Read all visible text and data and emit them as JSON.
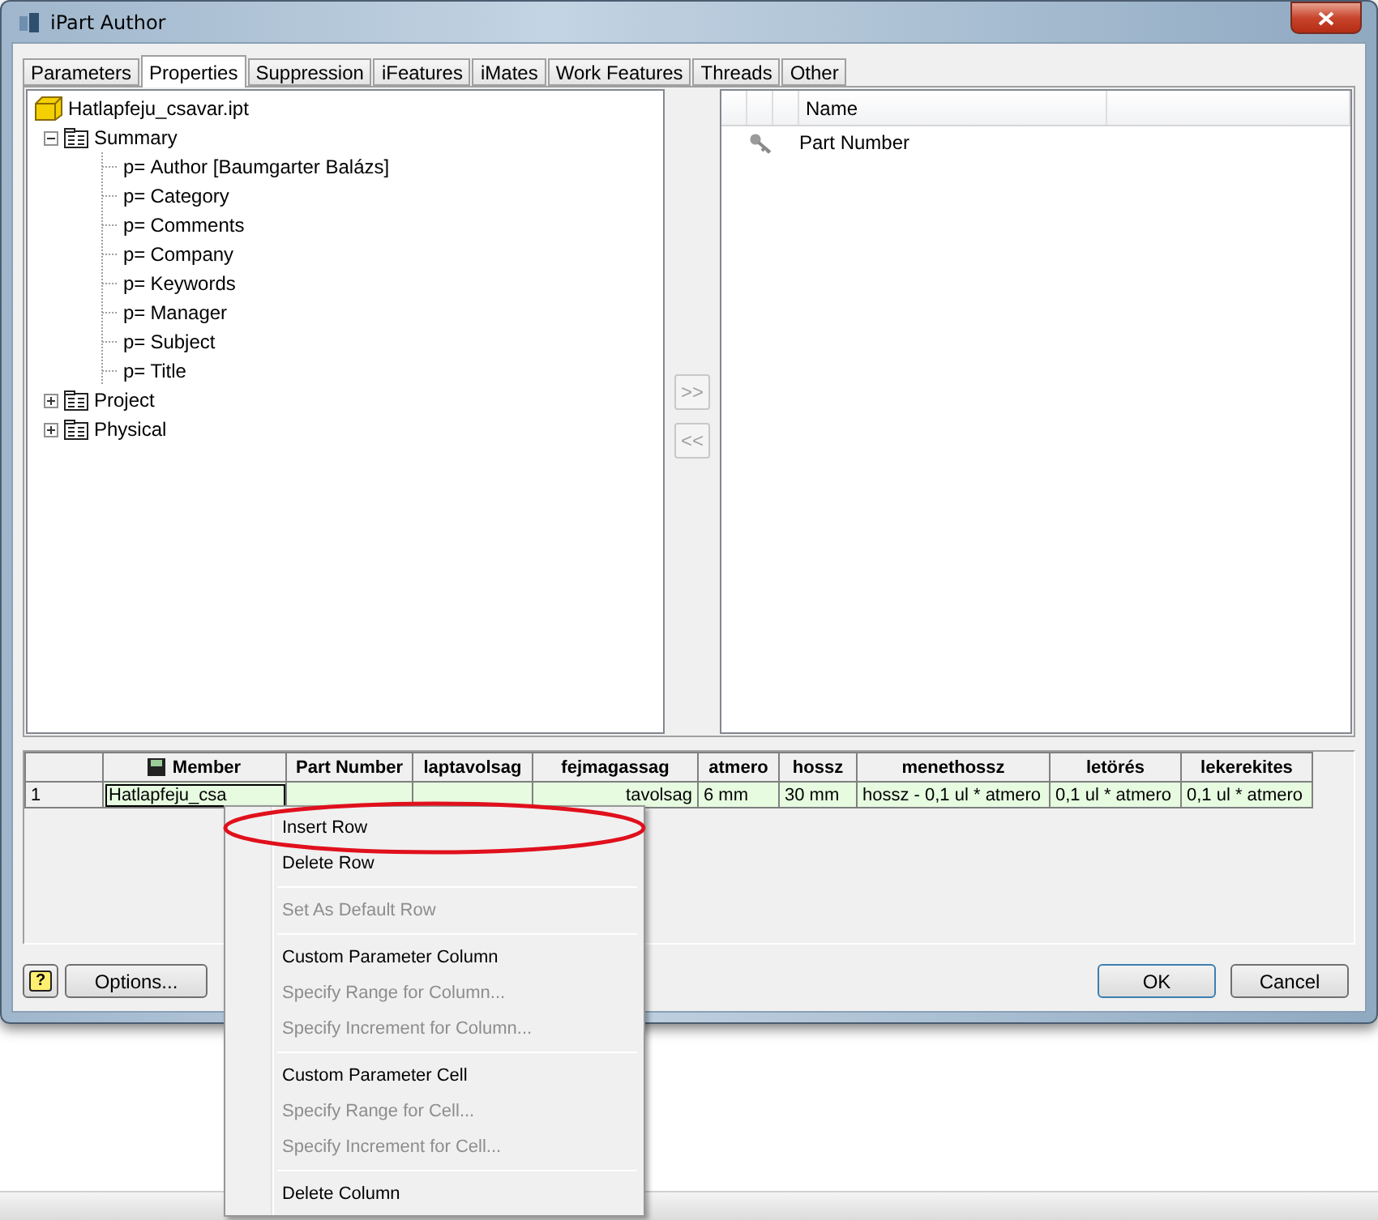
{
  "window": {
    "title": "iPart Author"
  },
  "tabs": [
    {
      "label": "Parameters",
      "selected": false
    },
    {
      "label": "Properties",
      "selected": true
    },
    {
      "label": "Suppression",
      "selected": false
    },
    {
      "label": "iFeatures",
      "selected": false
    },
    {
      "label": "iMates",
      "selected": false
    },
    {
      "label": "Work Features",
      "selected": false
    },
    {
      "label": "Threads",
      "selected": false
    },
    {
      "label": "Other",
      "selected": false
    }
  ],
  "tree": {
    "root": "Hatlapfeju_csavar.ipt",
    "children": [
      {
        "label": "Summary",
        "expanded": true,
        "children": [
          {
            "label": "Author [Baumgarter Balázs]",
            "icon_text": "p="
          },
          {
            "label": "Category",
            "icon_text": "p="
          },
          {
            "label": "Comments",
            "icon_text": "p="
          },
          {
            "label": "Company",
            "icon_text": "p="
          },
          {
            "label": "Keywords",
            "icon_text": "p="
          },
          {
            "label": "Manager",
            "icon_text": "p="
          },
          {
            "label": "Subject",
            "icon_text": "p="
          },
          {
            "label": "Title",
            "icon_text": "p="
          }
        ]
      },
      {
        "label": "Project",
        "expanded": false
      },
      {
        "label": "Physical",
        "expanded": false
      }
    ]
  },
  "move_buttons": [
    {
      "label": ">>",
      "disabled": true
    },
    {
      "label": "<<",
      "disabled": true
    }
  ],
  "selected_list": {
    "columns": [
      "Name"
    ],
    "rows": [
      {
        "name": "Part Number",
        "key": true
      }
    ]
  },
  "table": {
    "columns": [
      "Member",
      "Part Number",
      "laptavolsag",
      "fejmagassag",
      "atmero",
      "hossz",
      "menethossz",
      "letörés",
      "lekerekites"
    ],
    "rows": [
      {
        "row": "1",
        "cells": [
          "Hatlapfeju_csa",
          null,
          null,
          "tavolsag",
          "6 mm",
          "30 mm",
          "hossz - 0,1 ul * atmero",
          "0,1 ul * atmero",
          "0,1 ul * atmero"
        ]
      }
    ]
  },
  "buttons": {
    "help": "?",
    "options": "Options...",
    "ok": "OK",
    "cancel": "Cancel"
  },
  "context_menu": [
    {
      "kind": "item",
      "label": "Insert Row",
      "disabled": false,
      "circled": true
    },
    {
      "kind": "item",
      "label": "Delete Row",
      "disabled": false,
      "circled": false
    },
    {
      "kind": "separator"
    },
    {
      "kind": "item",
      "label": "Set As Default Row",
      "disabled": true,
      "circled": false
    },
    {
      "kind": "separator"
    },
    {
      "kind": "item",
      "label": "Custom Parameter Column",
      "disabled": false,
      "circled": false
    },
    {
      "kind": "item",
      "label": "Specify Range for Column...",
      "disabled": true,
      "circled": false
    },
    {
      "kind": "item",
      "label": "Specify Increment for Column...",
      "disabled": true,
      "circled": false
    },
    {
      "kind": "separator"
    },
    {
      "kind": "item",
      "label": "Custom Parameter Cell",
      "disabled": false,
      "circled": false
    },
    {
      "kind": "item",
      "label": "Specify Range for Cell...",
      "disabled": true,
      "circled": false
    },
    {
      "kind": "item",
      "label": "Specify Increment for Cell...",
      "disabled": true,
      "circled": false
    },
    {
      "kind": "separator"
    },
    {
      "kind": "item",
      "label": "Delete Column",
      "disabled": false,
      "circled": false
    }
  ]
}
